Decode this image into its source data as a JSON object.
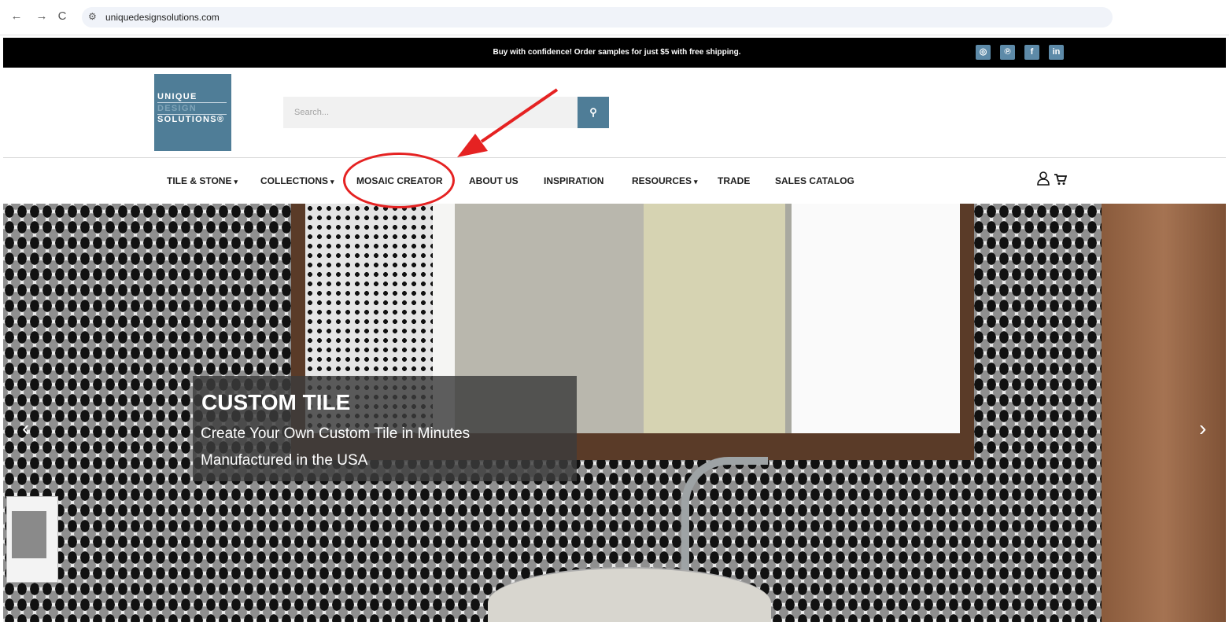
{
  "browser": {
    "back": "←",
    "forward": "→",
    "reload": "C",
    "url": "uniquedesignsolutions.com"
  },
  "announcement": {
    "text": "Buy with confidence! Order samples for just $5 with free shipping.",
    "social": [
      "instagram-icon",
      "pinterest-icon",
      "facebook-icon",
      "linkedin-icon"
    ],
    "social_glyphs": [
      "◎",
      "℗",
      "f",
      "in"
    ]
  },
  "header": {
    "logo_line1": "UNIQUE",
    "logo_line2": "DESIGN",
    "logo_line3": "SOLUTIONS®",
    "search_placeholder": "Search..."
  },
  "nav": {
    "items": [
      {
        "label": "TILE & STONE",
        "dropdown": true
      },
      {
        "label": "COLLECTIONS",
        "dropdown": true
      },
      {
        "label": "MOSAIC CREATOR",
        "dropdown": false
      },
      {
        "label": "ABOUT US",
        "dropdown": false
      },
      {
        "label": "INSPIRATION",
        "dropdown": false
      },
      {
        "label": "RESOURCES",
        "dropdown": true
      },
      {
        "label": "TRADE",
        "dropdown": false
      },
      {
        "label": "SALES CATALOG",
        "dropdown": false
      }
    ]
  },
  "hero": {
    "title": "CUSTOM TILE",
    "line1": "Create Your Own Custom Tile in Minutes",
    "line2": "Manufactured in the USA"
  },
  "colors": {
    "brand": "#4f7d97",
    "annotation": "#e52222"
  }
}
